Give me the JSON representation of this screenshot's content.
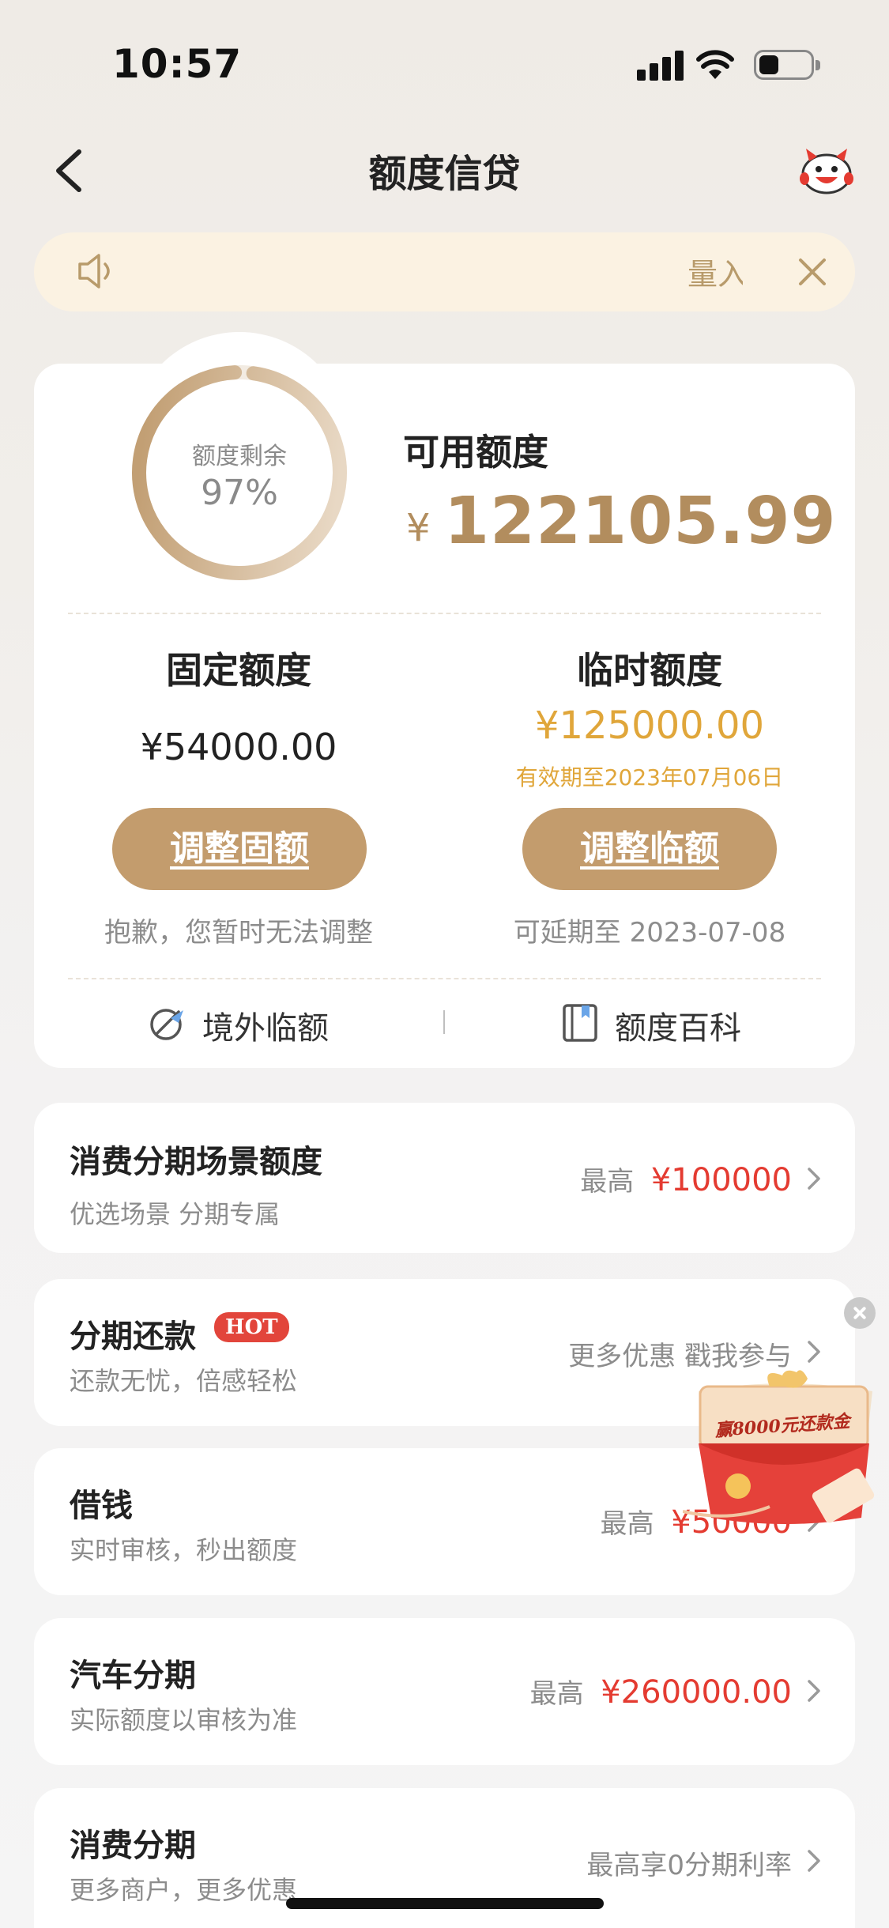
{
  "status_bar": {
    "time": "10:57"
  },
  "header": {
    "title": "额度信贷"
  },
  "notice": {
    "text": "量入"
  },
  "quota": {
    "ring_label": "额度剩余",
    "ring_percent_text": "97%",
    "ring_fraction": 0.97,
    "available_label": "可用额度",
    "currency": "¥",
    "available_amount": "122105.99",
    "fixed": {
      "title": "固定额度",
      "amount": "¥54000.00",
      "button": "调整固额",
      "note": "抱歉，您暂时无法调整"
    },
    "temporary": {
      "title": "临时额度",
      "amount": "¥125000.00",
      "valid": "有效期至2023年07月06日",
      "button": "调整临额",
      "note": "可延期至 2023-07-08"
    },
    "links": {
      "overseas": "境外临额",
      "wiki": "额度百科"
    }
  },
  "list": [
    {
      "title": "消费分期场景额度",
      "sub": "优选场景 分期专属",
      "prefix": "最高",
      "value": "¥100000"
    },
    {
      "title": "分期还款",
      "badge": "HOT",
      "sub": "还款无忧，倍感轻松",
      "right": "更多优惠 戳我参与"
    },
    {
      "title": "借钱",
      "sub": "实时审核，秒出额度",
      "prefix": "最高",
      "value": "¥50000"
    },
    {
      "title": "汽车分期",
      "sub": "实际额度以审核为准",
      "prefix": "最高",
      "value": "¥260000.00"
    },
    {
      "title": "消费分期",
      "sub": "更多商户，更多优惠",
      "right": "最高享0分期利率"
    }
  ],
  "promo": {
    "text": "赢8000元还款金"
  },
  "colors": {
    "gold": "#c39c6d",
    "accent_text": "#b28d5e",
    "red": "#e43b31",
    "temp_orange": "#e0a63a"
  }
}
